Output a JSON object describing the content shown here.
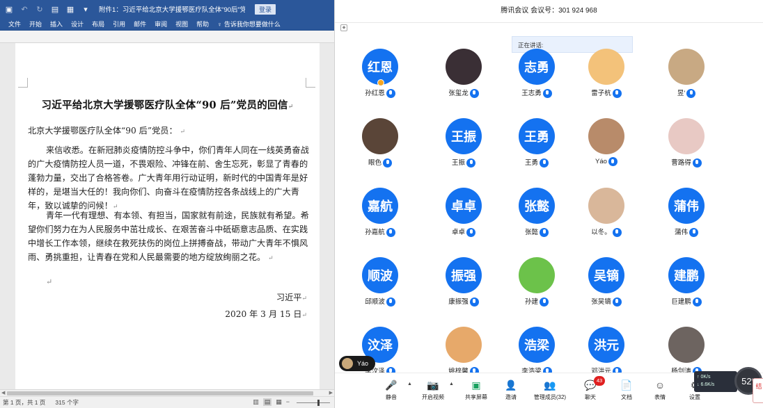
{
  "word": {
    "doc_title": "附件1：习近平给北京大学援鄂医疗队全体“90后”党员的...",
    "login_label": "登录",
    "tabs": [
      "文件",
      "开始",
      "插入",
      "设计",
      "布局",
      "引用",
      "邮件",
      "审阅",
      "视图",
      "帮助"
    ],
    "tell_me": "告诉我你想要做什么",
    "document": {
      "heading": "习近平给北京大学援鄂医疗队全体“90 后”党员的回信",
      "salutation": "北京大学援鄂医疗队全体“90 后”党员：",
      "paragraph_1": "来信收悉。在新冠肺炎疫情防控斗争中，你们青年人同在一线英勇奋战的广大疫情防控人员一道，不畏艰险、冲锋在前、舍生忘死，彰显了青春的蓬勃力量，交出了合格答卷。广大青年用行动证明，新时代的中国青年是好样的，是堪当大任的！我向你们、向奋斗在疫情防控各条战线上的广大青年，致以诚挚的问候！",
      "paragraph_2": "青年一代有理想、有本领、有担当，国家就有前途，民族就有希望。希望你们努力在为人民服务中茁壮成长、在艰苦奋斗中砥砺意志品质、在实践中增长工作本领，继续在救死扶伤的岗位上拼搏奋战，带动广大青年不惧风雨、勇挑重担，让青春在党和人民最需要的地方绽放绚丽之花。",
      "signer": "习近平",
      "date": "2020 年 3 月 15 日",
      "pilcrow": "↵"
    },
    "status": {
      "page": "第 1 页，共 1 页",
      "words": "315 个字"
    }
  },
  "meeting": {
    "title": "腾讯会议  会议号：301 924 968",
    "speaking_label": "正在讲话:",
    "participants": [
      {
        "avatar": "红恩",
        "name": "孙红恩",
        "host": true
      },
      {
        "avatar": "",
        "name": "张玺龙",
        "photo_color": "#3a2f35"
      },
      {
        "avatar": "志勇",
        "name": "王志勇"
      },
      {
        "avatar": "",
        "name": "雷子杭",
        "photo_color": "#f3c27a"
      },
      {
        "avatar": "",
        "name": "昱'",
        "photo_color": "#c8a983"
      },
      {
        "avatar": "",
        "name": "眼色",
        "photo_color": "#5a4538"
      },
      {
        "avatar": "王振",
        "name": "王振"
      },
      {
        "avatar": "王勇",
        "name": "王勇"
      },
      {
        "avatar": "",
        "name": "Yáo",
        "photo_color": "#b88b6a"
      },
      {
        "avatar": "",
        "name": "曹路得",
        "photo_color": "#e8c9c4"
      },
      {
        "avatar": "嘉航",
        "name": "孙嘉航"
      },
      {
        "avatar": "卓卓",
        "name": "卓卓"
      },
      {
        "avatar": "张懿",
        "name": "张懿"
      },
      {
        "avatar": "",
        "name": "以冬。",
        "photo_color": "#d9b79a"
      },
      {
        "avatar": "蒲伟",
        "name": "蒲伟"
      },
      {
        "avatar": "顺波",
        "name": "邱顺波"
      },
      {
        "avatar": "振强",
        "name": "康振强"
      },
      {
        "avatar": "",
        "name": "孙建",
        "photo_color": "#6cc24a"
      },
      {
        "avatar": "吴镝",
        "name": "张吴镝"
      },
      {
        "avatar": "建鹏",
        "name": "巨建鹏"
      },
      {
        "avatar": "汶泽",
        "name": "李汶泽"
      },
      {
        "avatar": "",
        "name": "姚梓馨",
        "photo_color": "#e7a96a"
      },
      {
        "avatar": "浩梁",
        "name": "李浩梁"
      },
      {
        "avatar": "洪元",
        "name": "邓洪元"
      },
      {
        "avatar": "",
        "name": "杨剑涛",
        "photo_color": "#6d6460"
      }
    ],
    "self_pill": "Yáo",
    "toolbar": [
      {
        "label": "静音",
        "icon": "microphone-icon",
        "glyph": "🎤"
      },
      {
        "label": "开启视频",
        "icon": "video-off-icon",
        "glyph": "📷"
      },
      {
        "label": "共享屏幕",
        "icon": "share-screen-icon",
        "glyph": "▣"
      },
      {
        "label": "邀请",
        "icon": "invite-icon",
        "glyph": "👤"
      },
      {
        "label": "管理成员(32)",
        "icon": "members-icon",
        "glyph": "👥"
      },
      {
        "label": "聊天",
        "icon": "chat-icon",
        "glyph": "💬"
      },
      {
        "label": "文档",
        "icon": "document-icon",
        "glyph": "📄"
      },
      {
        "label": "表情",
        "icon": "emoji-icon",
        "glyph": "☺"
      },
      {
        "label": "设置",
        "icon": "settings-icon",
        "glyph": "⚙"
      }
    ],
    "chat_badge": "43",
    "network": {
      "up": "0K/s",
      "down": "6.6K/s",
      "cpu": "52",
      "cpu_unit": "%"
    },
    "side_tab": "结"
  }
}
